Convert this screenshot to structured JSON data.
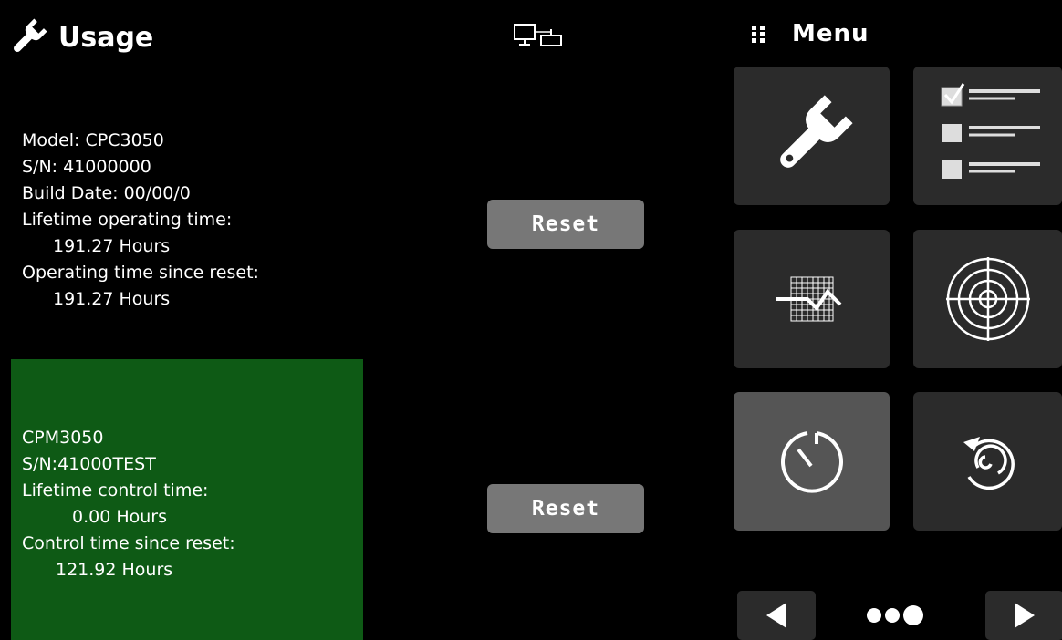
{
  "header": {
    "title": "Usage",
    "title_icon": "wrench-icon",
    "connection_icon": "monitor-network-icon"
  },
  "menu": {
    "label": "Menu",
    "icon": "grid-dots-icon"
  },
  "controller": {
    "model": "Model: CPC3050",
    "serial": "S/N: 41000000",
    "build_date": "Build Date: 00/00/0",
    "lifetime_label": "Lifetime operating time:",
    "lifetime_value": "191.27 Hours",
    "since_reset_label": "Operating time since reset:",
    "since_reset_value": "191.27 Hours",
    "reset_label": "Reset"
  },
  "module": {
    "model": "CPM3050",
    "serial": "S/N:41000TEST",
    "lifetime_label": "Lifetime control time:",
    "lifetime_value": "0.00 Hours",
    "since_reset_label": "Control time since reset:",
    "since_reset_value": "121.92 Hours",
    "reset_label": "Reset",
    "panel_color": "#0e5a15"
  },
  "tiles": [
    {
      "icon": "wrench-icon",
      "active": false
    },
    {
      "icon": "checklist-icon",
      "active": false
    },
    {
      "icon": "chart-grid-icon",
      "active": false
    },
    {
      "icon": "target-icon",
      "active": false
    },
    {
      "icon": "timer-icon",
      "active": true
    },
    {
      "icon": "spiral-arrow-icon",
      "active": false
    }
  ],
  "pager": {
    "prev_icon": "triangle-left-icon",
    "next_icon": "triangle-right-icon",
    "pages": 3,
    "current": 3
  }
}
